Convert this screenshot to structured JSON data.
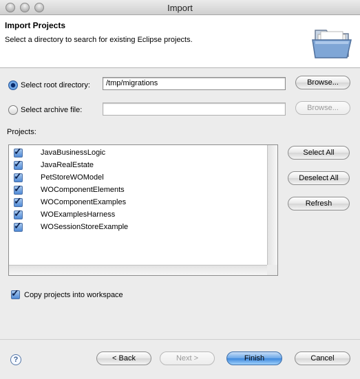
{
  "window": {
    "title": "Import"
  },
  "banner": {
    "heading": "Import Projects",
    "description": "Select a directory to search for existing Eclipse projects.",
    "icon": "folder-icon"
  },
  "source": {
    "root_label": "Select root directory:",
    "root_value": "/tmp/migrations",
    "root_selected": true,
    "archive_label": "Select archive file:",
    "archive_value": "",
    "archive_selected": false,
    "browse_label": "Browse...",
    "browse_archive_label": "Browse..."
  },
  "projects": {
    "label": "Projects:",
    "items": [
      {
        "name": "JavaBusinessLogic",
        "checked": true
      },
      {
        "name": "JavaRealEstate",
        "checked": true
      },
      {
        "name": "PetStoreWOModel",
        "checked": true
      },
      {
        "name": "WOComponentElements",
        "checked": true
      },
      {
        "name": "WOComponentExamples",
        "checked": true
      },
      {
        "name": "WOExamplesHarness",
        "checked": true
      },
      {
        "name": "WOSessionStoreExample",
        "checked": true
      }
    ],
    "select_all_label": "Select All",
    "deselect_all_label": "Deselect All",
    "refresh_label": "Refresh"
  },
  "options": {
    "copy_label": "Copy projects into workspace",
    "copy_checked": true
  },
  "footer": {
    "help_glyph": "?",
    "back_label": "< Back",
    "next_label": "Next >",
    "finish_label": "Finish",
    "cancel_label": "Cancel"
  },
  "colors": {
    "accent": "#3e87dc",
    "check": "#4f8ad6"
  }
}
